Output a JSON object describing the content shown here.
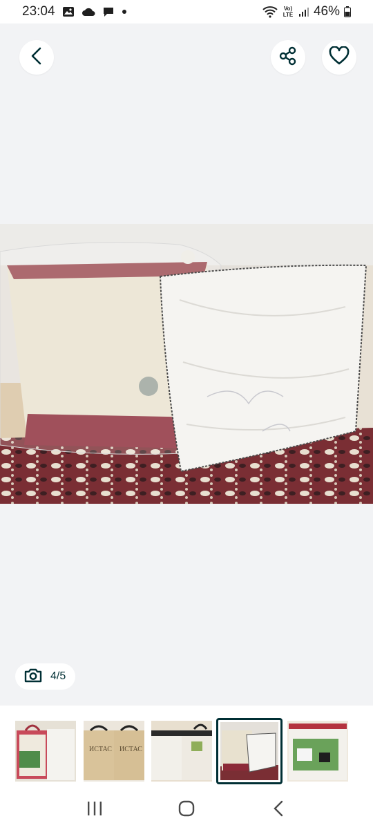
{
  "status_bar": {
    "time": "23:04",
    "volte_label": "Vo) LTE",
    "battery": "46%"
  },
  "viewer": {
    "photo_description_icon": "camera-icon",
    "counter": "4/5"
  },
  "colors": {
    "accent": "#002f34",
    "background": "#f2f3f5"
  },
  "thumbnails": [
    {
      "index": 1,
      "active": false
    },
    {
      "index": 2,
      "active": false
    },
    {
      "index": 3,
      "active": false
    },
    {
      "index": 4,
      "active": true
    },
    {
      "index": 5,
      "active": false
    }
  ],
  "thumb_texts": {
    "t2_left": "ИСТАС",
    "t2_right": "ИСТАС"
  }
}
